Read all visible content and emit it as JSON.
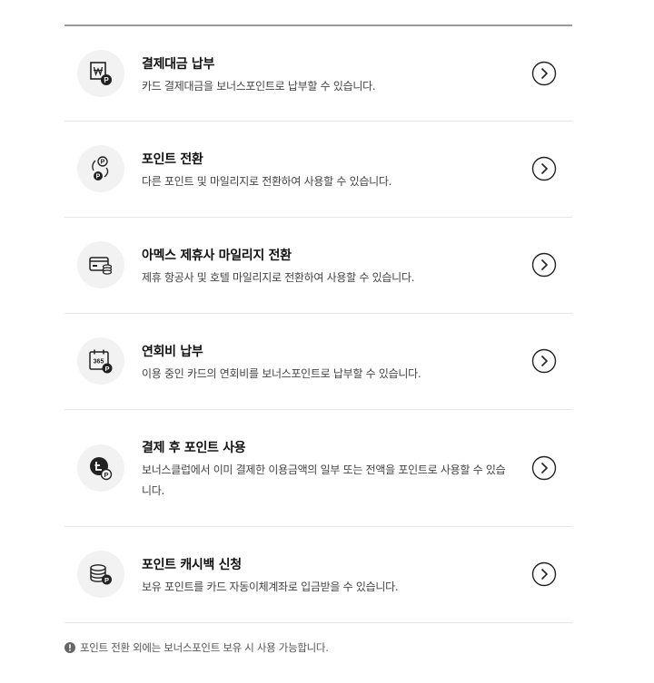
{
  "items": [
    {
      "icon": "won-point-icon",
      "title": "결제대금 납부",
      "description": "카드 결제대금을 보너스포인트로 납부할 수 있습니다."
    },
    {
      "icon": "point-exchange-icon",
      "title": "포인트 전환",
      "description": "다른 포인트 및 마일리지로 전환하여 사용할 수 있습니다."
    },
    {
      "icon": "card-coins-icon",
      "title": "아멕스 제휴사 마일리지 전환",
      "description": "제휴 항공사 및 호텔 마일리지로 전환하여 사용할 수 있습니다."
    },
    {
      "icon": "calendar-365-icon",
      "title": "연회비 납부",
      "description": "이용 중인 카드의 연회비를 보너스포인트로 납부할 수 있습니다."
    },
    {
      "icon": "refund-point-icon",
      "title": "결제 후 포인트 사용",
      "description": "보너스클럽에서 이미 결제한 이용금액의 일부 또는 전액을 포인트로 사용할 수 있습니다."
    },
    {
      "icon": "coin-stack-icon",
      "title": "포인트 캐시백 신청",
      "description": "보유 포인트를 카드 자동이체계좌로 입금받을 수 있습니다."
    }
  ],
  "note": {
    "icon": "info-icon",
    "text": "포인트 전환 외에는 보너스포인트 보유 시 사용 가능합니다."
  }
}
